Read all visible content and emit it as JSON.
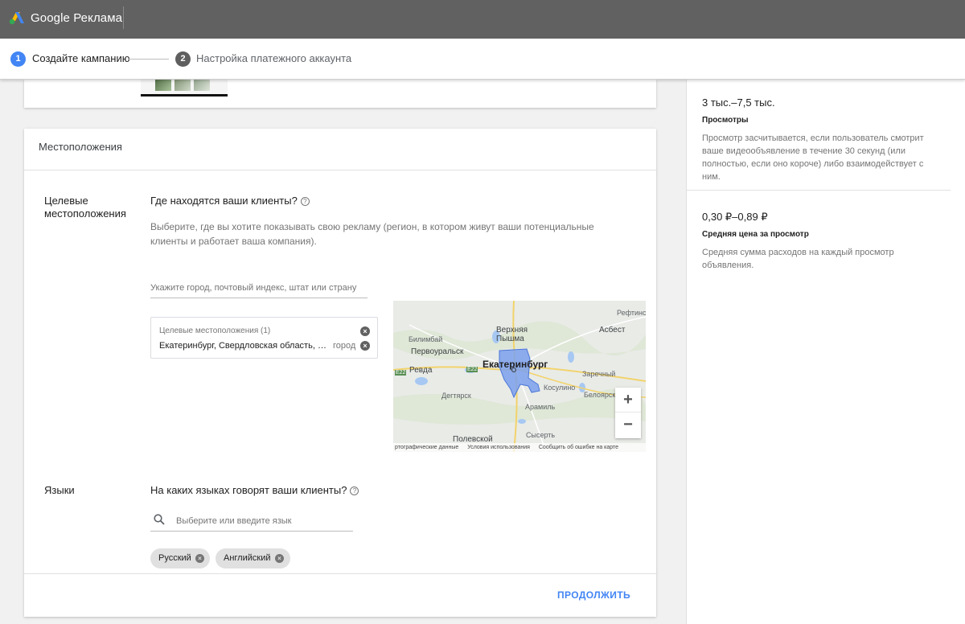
{
  "header": {
    "app_name": "Google Реклама",
    "brand_colors": [
      "#fbbc04",
      "#4285f4",
      "#34a853"
    ]
  },
  "stepper": {
    "steps": [
      {
        "number": "1",
        "label": "Создайте кампанию",
        "active": true
      },
      {
        "number": "2",
        "label": "Настройка платежного аккаунта",
        "active": false
      }
    ]
  },
  "locations": {
    "card_title": "Местоположения",
    "section_label": "Целевые местоположения",
    "question": "Где находятся ваши клиенты?",
    "description": "Выберите, где вы хотите показывать свою рекламу (регион, в котором живут ваши потенциальные клиенты и работает ваша компания).",
    "search_placeholder": "Укажите город, почтовый индекс, штат или страну",
    "selected_box_header": "Целевые местоположения (1)",
    "selected": [
      {
        "name": "Екатеринбург, Свердловская область, Россия",
        "type": "город"
      }
    ]
  },
  "map": {
    "labels": {
      "refti": "Рефтинс",
      "asbest": "Асбест",
      "bilimbay": "Билимбай",
      "vpyshma": "Верхняя Пышма",
      "pervouralsk": "Первоуральск",
      "ekb": "Екатеринбург",
      "revda": "Ревда",
      "e22a": "E22",
      "e22b": "E22",
      "zarechny": "Заречный",
      "kosulino": "Косулино",
      "beloyarsk": "Белоярск",
      "degtyarsk": "Дегтярск",
      "aramil": "Арамиль",
      "sysert": "Сысерть",
      "polevskoy": "Полевской"
    },
    "footer": [
      "ртографические данные",
      "Условия использования",
      "Сообщить об ошибке на карте"
    ],
    "zoom_in": "+",
    "zoom_out": "−",
    "highlight_color": "#7ba0ec"
  },
  "languages": {
    "section_label": "Языки",
    "question": "На каких языках говорят ваши клиенты?",
    "search_placeholder": "Выберите или введите язык",
    "chips": [
      "Русский",
      "Английский"
    ]
  },
  "actions": {
    "continue_label": "ПРОДОЛЖИТЬ"
  },
  "sidebar": {
    "metrics": [
      {
        "value": "3 тыс.–7,5 тыс.",
        "name": "Просмотры",
        "description": "Просмотр засчитывается, если пользователь смотрит ваше видеообъявление в течение 30 секунд (или полностью, если оно короче) либо взаимодействует с ним."
      },
      {
        "value": "0,30 ₽–0,89 ₽",
        "name": "Средняя цена за просмотр",
        "description": "Средняя сумма расходов на каждый просмотр объявления."
      }
    ]
  }
}
